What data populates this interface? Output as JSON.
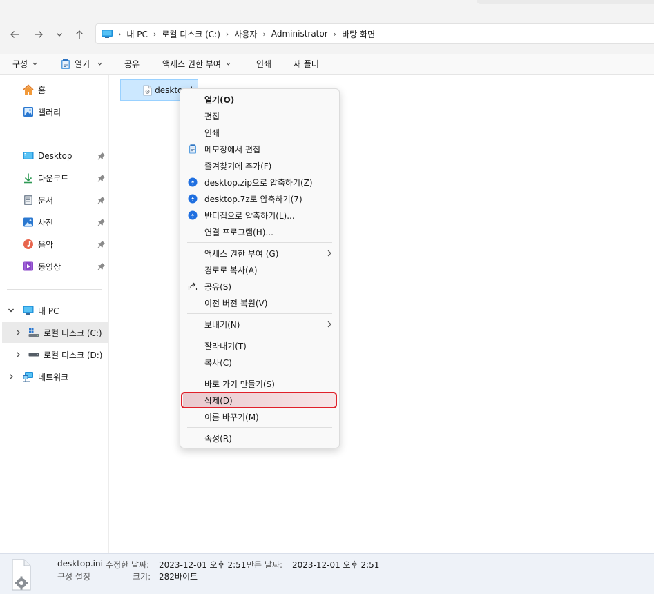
{
  "address": {
    "crumbs": [
      "내 PC",
      "로컬 디스크 (C:)",
      "사용자",
      "Administrator",
      "바탕 화면"
    ]
  },
  "toolbar": {
    "organize": "구성",
    "open": "열기",
    "share": "공유",
    "access": "액세스 권한 부여",
    "print": "인쇄",
    "new_folder": "새 폴더"
  },
  "sidebar": {
    "home": "홈",
    "gallery": "갤러리",
    "desktop": "Desktop",
    "downloads": "다운로드",
    "documents": "문서",
    "pictures": "사진",
    "music": "음악",
    "videos": "동영상",
    "this_pc": "내 PC",
    "drive_c": "로컬 디스크 (C:)",
    "drive_d": "로컬 디스크 (D:)",
    "network": "네트워크"
  },
  "file": {
    "name": "desktop.ini"
  },
  "context_menu": {
    "open": "열기(O)",
    "edit": "편집",
    "print": "인쇄",
    "notepad_edit": "메모장에서 편집",
    "add_favorites": "즐겨찾기에 추가(F)",
    "zip": "desktop.zip으로 압축하기(Z)",
    "sevenz": "desktop.7z로 압축하기(7)",
    "bandizip": "반디집으로 압축하기(L)...",
    "open_with": "연결 프로그램(H)...",
    "give_access": "액세스 권한 부여 (G)",
    "copy_path": "경로로 복사(A)",
    "share": "공유(S)",
    "restore": "이전 버전 복원(V)",
    "send_to": "보내기(N)",
    "cut": "잘라내기(T)",
    "copy": "복사(C)",
    "create_shortcut": "바로 가기 만들기(S)",
    "delete": "삭제(D)",
    "rename": "이름 바꾸기(M)",
    "properties": "속성(R)"
  },
  "details": {
    "filename": "desktop.ini",
    "type": "구성 설정",
    "modified_key": "수정한 날짜:",
    "modified_val": "2023-12-01 오후 2:51",
    "created_key": "만든 날짜:",
    "created_val": "2023-12-01 오후 2:51",
    "size_key": "크기:",
    "size_val": "282바이트"
  },
  "colors": {
    "highlight_border": "#e0202a",
    "selection_bg": "#cce8ff",
    "accent": "#0067c0",
    "bandizip_blue": "#1f6fe0"
  }
}
